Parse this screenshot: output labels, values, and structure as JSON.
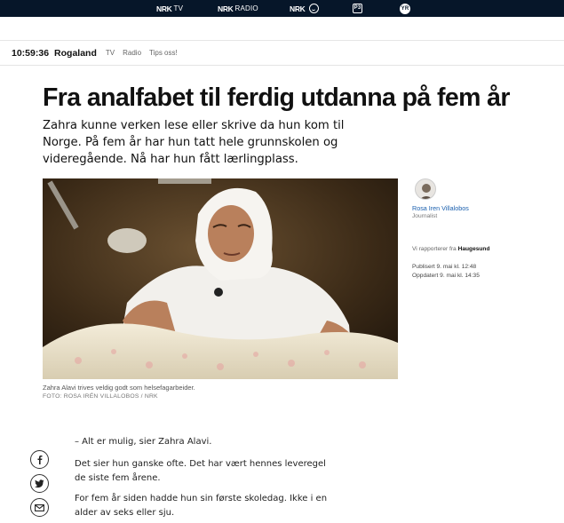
{
  "topbar": {
    "nrk_tv": {
      "logo": "NRK",
      "sub": "TV"
    },
    "nrk_radio": {
      "logo": "NRK",
      "sub": "RADIO"
    },
    "nrk_super": {
      "logo": "NRK"
    },
    "p3": {
      "text": "P3"
    },
    "yr": {
      "text": "YR"
    }
  },
  "district": {
    "time": "10:59:36",
    "region": "Rogaland",
    "links": [
      "TV",
      "Radio",
      "Tips oss!"
    ]
  },
  "article": {
    "headline": "Fra analfabet til ferdig utdanna på fem år",
    "lead": "Zahra kunne verken lese eller skrive da hun kom til Norge. På fem år har hun tatt hele grunnskolen og videregående. Nå har hun fått lærlingplass.",
    "image_caption": "Zahra Alavi trives veldig godt som helsefagarbeider.",
    "image_credit": "FOTO: ROSA IRÉN VILLALOBOS / NRK",
    "paragraphs": [
      "– Alt er mulig, sier Zahra Alavi.",
      "Det sier hun ganske ofte. Det har vært hennes leveregel de siste fem årene.",
      "For fem år siden hadde hun sin første skoledag. Ikke i en alder av seks eller sju."
    ]
  },
  "byline": {
    "name": "Rosa Iren Villalobos",
    "role": "Journalist",
    "reports_prefix": "Vi rapporterer fra",
    "reports_place": "Haugesund",
    "published": "Publisert 9. mai kl. 12:48",
    "updated": "Oppdatert 9. mai kl. 14:35"
  },
  "share": {
    "icons": [
      "facebook-icon",
      "twitter-icon",
      "email-icon"
    ]
  },
  "colors": {
    "topbar_bg": "#061629",
    "link": "#1a5fae",
    "text": "#111111"
  }
}
